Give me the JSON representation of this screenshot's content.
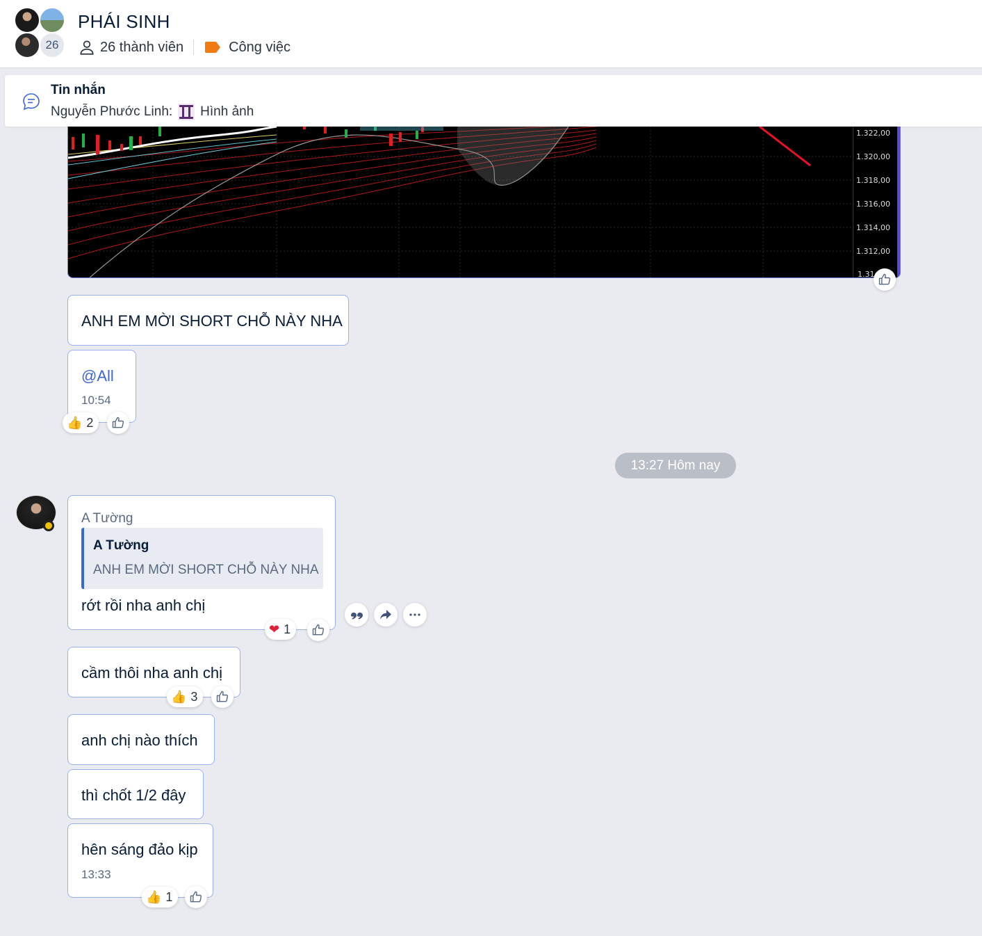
{
  "header": {
    "title": "PHÁI SINH",
    "avatar_count": "26",
    "members": "26 thành viên",
    "tag": "Công việc",
    "tag_color": "#f07b15"
  },
  "pinned": {
    "title": "Tin nhắn",
    "sender": "Nguyễn Phước Linh:",
    "content": "Hình ảnh"
  },
  "chart_image": {
    "y_ticks": [
      "1.322,00",
      "1.320,00",
      "1.318,00",
      "1.316,00",
      "1.314,00",
      "1.312,00",
      "1.31"
    ]
  },
  "messages": {
    "m1": {
      "text": "ANH EM MỜI SHORT CHỖ NÀY NHA"
    },
    "m2": {
      "text": "@All",
      "time": "10:54",
      "reaction": "2"
    },
    "divider": "13:27 Hôm nay",
    "m3": {
      "sender": "A Tường",
      "quote_name": "A Tường",
      "quote_text": "ANH EM MỜI SHORT CHỖ NÀY NHA",
      "text": "rớt rồi nha anh chị",
      "reaction": "1"
    },
    "m4": {
      "text": "cầm thôi nha anh chị",
      "reaction": "3"
    },
    "m5": {
      "text": "anh chị nào thích"
    },
    "m6": {
      "text": "thì chốt 1/2 đây"
    },
    "m7": {
      "text": "hên sáng đảo kịp",
      "time": "13:33",
      "reaction": "1"
    }
  }
}
